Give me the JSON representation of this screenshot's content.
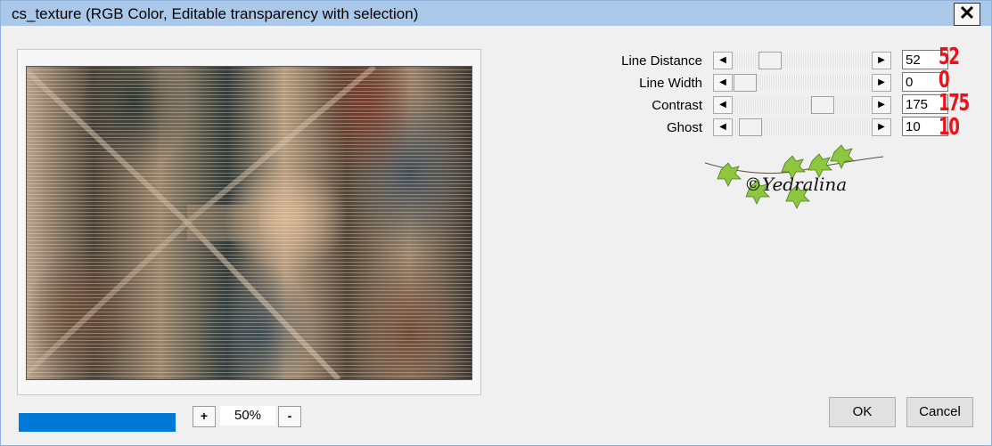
{
  "window": {
    "title": "cs_texture (RGB Color, Editable transparency with selection)",
    "close_symbol": "✕"
  },
  "zoom": {
    "plus_label": "+",
    "minus_label": "-",
    "value": "50%"
  },
  "progress": {
    "fraction": 1.0,
    "color": "#0078d7"
  },
  "parameters": [
    {
      "label": "Line Distance",
      "value": "52",
      "slider_fraction": 0.22,
      "annotation": "52"
    },
    {
      "label": "Line Width",
      "value": "0",
      "slider_fraction": 0.0,
      "annotation": "0"
    },
    {
      "label": "Contrast",
      "value": "175",
      "slider_fraction": 0.68,
      "annotation": "175"
    },
    {
      "label": "Ghost",
      "value": "10",
      "slider_fraction": 0.05,
      "annotation": "10"
    }
  ],
  "slider_arrows": {
    "left": "◀",
    "right": "▶"
  },
  "watermark": {
    "text": "©Yedralina"
  },
  "buttons": {
    "ok": "OK",
    "cancel": "Cancel"
  },
  "colors": {
    "annotation": "#e8141a",
    "titlebar": "#a9c8ea"
  }
}
